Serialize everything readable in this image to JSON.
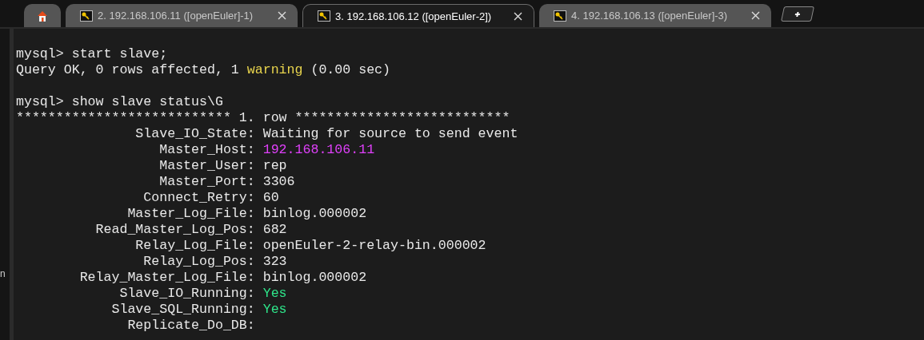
{
  "tabs": [
    {
      "kind": "home",
      "selected": false
    },
    {
      "kind": "session",
      "label": "2. 192.168.106.11 ([openEuler]-1)",
      "selected": false
    },
    {
      "kind": "session",
      "label": "3. 192.168.106.12 ([openEuler-2])",
      "selected": true
    },
    {
      "kind": "session",
      "label": "4. 192.168.106.13 ([openEuler]-3)",
      "selected": false
    }
  ],
  "sidebar": {
    "fragment": "n"
  },
  "terminal": {
    "lines": [
      {
        "kind": "blank"
      },
      {
        "kind": "text",
        "segments": [
          {
            "text": "mysql> start slave;"
          }
        ]
      },
      {
        "kind": "text",
        "segments": [
          {
            "text": "Query OK, 0 rows affected, 1 "
          },
          {
            "text": "warning",
            "color": "#e8d44d"
          },
          {
            "text": " (0.00 sec)"
          }
        ]
      },
      {
        "kind": "blank"
      },
      {
        "kind": "text",
        "segments": [
          {
            "text": "mysql> show slave status\\G"
          }
        ]
      },
      {
        "kind": "text",
        "segments": [
          {
            "text": "*************************** 1. row ***************************"
          }
        ]
      },
      {
        "kind": "field",
        "field": "Slave_IO_State:",
        "value": "Waiting for source to send event"
      },
      {
        "kind": "field",
        "field": "Master_Host:",
        "value": "192.168.106.11",
        "color": "#e040fb"
      },
      {
        "kind": "field",
        "field": "Master_User:",
        "value": "rep"
      },
      {
        "kind": "field",
        "field": "Master_Port:",
        "value": "3306"
      },
      {
        "kind": "field",
        "field": "Connect_Retry:",
        "value": "60"
      },
      {
        "kind": "field",
        "field": "Master_Log_File:",
        "value": "binlog.000002"
      },
      {
        "kind": "field",
        "field": "Read_Master_Log_Pos:",
        "value": "682"
      },
      {
        "kind": "field",
        "field": "Relay_Log_File:",
        "value": "openEuler-2-relay-bin.000002"
      },
      {
        "kind": "field",
        "field": "Relay_Log_Pos:",
        "value": "323"
      },
      {
        "kind": "field",
        "field": "Relay_Master_Log_File:",
        "value": "binlog.000002"
      },
      {
        "kind": "field",
        "field": "Slave_IO_Running:",
        "value": "Yes",
        "color": "#2ee58a"
      },
      {
        "kind": "field",
        "field": "Slave_SQL_Running:",
        "value": "Yes",
        "color": "#2ee58a"
      },
      {
        "kind": "field",
        "field": "Replicate_Do_DB:"
      }
    ]
  }
}
